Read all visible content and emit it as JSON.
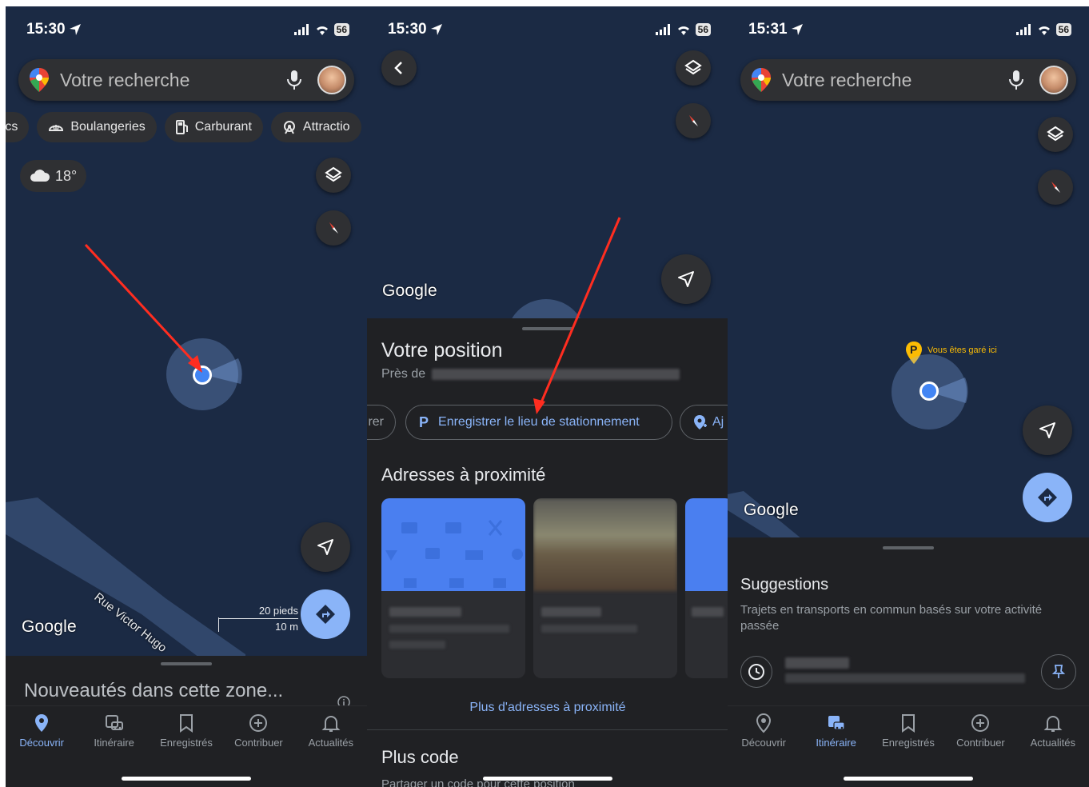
{
  "colors": {
    "map_bg": "#1b2a44",
    "sheet_bg": "#202124",
    "chip_bg": "#2f3033",
    "accent": "#8ab4f8",
    "location_dot": "#4285f4",
    "annotation_arrow": "#ff2d20",
    "parking_pin": "#fbbc04"
  },
  "panel1": {
    "status_time": "15:30",
    "battery": "56",
    "search_placeholder": "Votre recherche",
    "chips": [
      {
        "label": "rcs",
        "icon": "park-icon"
      },
      {
        "label": "Boulangeries",
        "icon": "bakery-icon"
      },
      {
        "label": "Carburant",
        "icon": "fuel-icon"
      },
      {
        "label": "Attractio",
        "icon": "attraction-icon"
      }
    ],
    "weather": "18°",
    "road_label": "Rue Victor Hugo",
    "scale_top": "20 pieds",
    "scale_bottom": "10 m",
    "google_logo": "Google",
    "sheet_title": "Nouveautés dans cette zone...",
    "nav": [
      {
        "label": "Découvrir",
        "active": true
      },
      {
        "label": "Itinéraire",
        "active": false
      },
      {
        "label": "Enregistrés",
        "active": false
      },
      {
        "label": "Contribuer",
        "active": false
      },
      {
        "label": "Actualités",
        "active": false
      }
    ]
  },
  "panel2": {
    "status_time": "15:30",
    "battery": "56",
    "google_logo": "Google",
    "title": "Votre position",
    "near_prefix": "Près de",
    "left_chip": "rer",
    "parking_chip": "Enregistrer le lieu de stationnement",
    "parking_letter": "P",
    "right_chip": "Aj",
    "nearby_title": "Adresses à proximité",
    "more_nearby": "Plus d'adresses à proximité",
    "plus_code_title": "Plus code",
    "plus_code_sub": "Partager un code pour cette position"
  },
  "panel3": {
    "status_time": "15:31",
    "battery": "56",
    "search_placeholder": "Votre recherche",
    "parking_letter": "P",
    "parked_label": "Vous êtes garé ici",
    "google_logo": "Google",
    "suggestions_title": "Suggestions",
    "suggestions_sub": "Trajets en transports en commun basés sur votre activité passée",
    "nav": [
      {
        "label": "Découvrir",
        "active": false
      },
      {
        "label": "Itinéraire",
        "active": true
      },
      {
        "label": "Enregistrés",
        "active": false
      },
      {
        "label": "Contribuer",
        "active": false
      },
      {
        "label": "Actualités",
        "active": false
      }
    ]
  }
}
